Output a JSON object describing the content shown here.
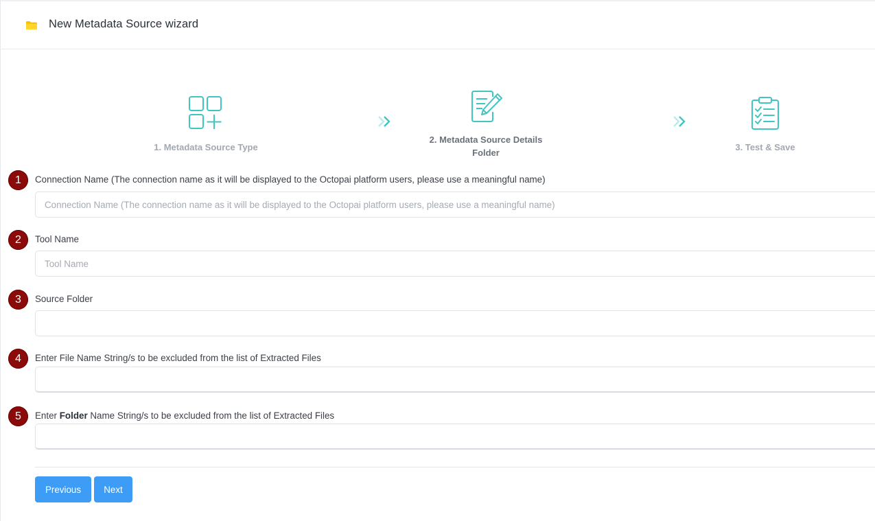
{
  "header": {
    "title": "New Metadata Source wizard",
    "icon": "folder-icon",
    "icon_color": "#f5c400"
  },
  "steps": [
    {
      "label": "1. Metadata Source Type",
      "icon": "apps-add-icon",
      "state": "done"
    },
    {
      "label_line1": "2. Metadata Source Details",
      "label_line2": "Folder",
      "icon": "edit-document-icon",
      "state": "active"
    },
    {
      "label": "3. Test & Save",
      "icon": "clipboard-checklist-icon",
      "state": "pending"
    }
  ],
  "accent_color": "#3fc6c2",
  "form": {
    "fields": [
      {
        "number": "1",
        "label": "Connection Name (The connection name as it will be displayed to the Octopai platform users, please use a meaningful name)",
        "placeholder": "Connection Name (The connection name as it will be displayed to the Octopai platform users, please use a meaningful name)",
        "value": ""
      },
      {
        "number": "2",
        "label": "Tool Name",
        "placeholder": "Tool Name",
        "value": ""
      },
      {
        "number": "3",
        "label": "Source Folder",
        "placeholder": "",
        "value": ""
      },
      {
        "number": "4",
        "label": "Enter File Name String/s to be excluded from the list of Extracted Files",
        "placeholder": "",
        "value": ""
      },
      {
        "number": "5",
        "label_prefix": "Enter ",
        "label_bold": "Folder",
        "label_suffix": " Name String/s to be excluded from the list of Extracted Files",
        "placeholder": "",
        "value": ""
      }
    ]
  },
  "buttons": {
    "previous": "Previous",
    "next": "Next",
    "color": "#3d9cf6"
  },
  "badge_color": "#8b0a0a"
}
